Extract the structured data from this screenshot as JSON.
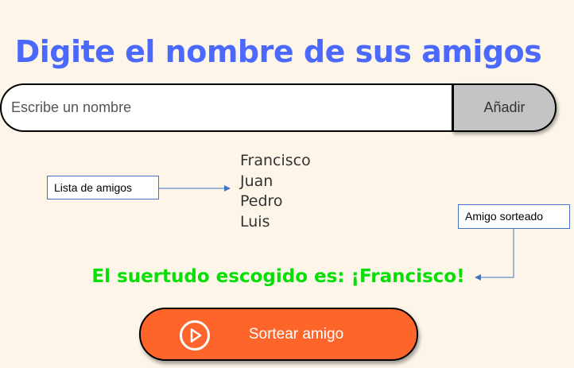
{
  "header": {
    "title": "Digite el nombre de sus amigos"
  },
  "input_section": {
    "placeholder": "Escribe un nombre",
    "value": "",
    "add_label": "Añadir"
  },
  "friends": [
    "Francisco",
    "Juan",
    "Pedro",
    "Luis"
  ],
  "annotations": {
    "list_label": "Lista de amigos",
    "drawn_label": "Amigo sorteado"
  },
  "result": {
    "text": "El suertudo escogido es: ¡Francisco!"
  },
  "draw_button": {
    "label": "Sortear amigo",
    "icon": "play-circle-icon"
  },
  "colors": {
    "background": "#fdf6e8",
    "title": "#4b69fd",
    "result": "#05df05",
    "draw_button": "#fe652b",
    "add_button": "#c4c4c4",
    "annotation_border": "#4472c4"
  }
}
